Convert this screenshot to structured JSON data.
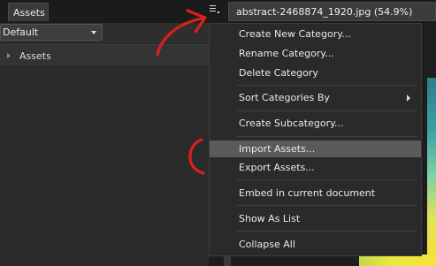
{
  "topbar": {
    "panel_tab": "Assets",
    "document_tab": "abstract-2468874_1920.jpg (54.9%)"
  },
  "toolbar": {
    "category_select": "Default"
  },
  "panel": {
    "category_label": "Assets"
  },
  "context_menu": {
    "items": [
      {
        "label": "Create New Category..."
      },
      {
        "label": "Rename Category..."
      },
      {
        "label": "Delete Category"
      },
      {
        "label": "Sort Categories By"
      },
      {
        "label": "Create Subcategory..."
      },
      {
        "label": "Import Assets..."
      },
      {
        "label": "Export Assets..."
      },
      {
        "label": "Embed in current document"
      },
      {
        "label": "Show As List"
      },
      {
        "label": "Collapse All"
      }
    ],
    "highlighted": "Import Assets...",
    "has_submenu": "Sort Categories By"
  },
  "colors": {
    "annotation_red": "#d8201f",
    "highlight": "#5a5a5a",
    "menu_bg": "#2a2a2a"
  },
  "icons": {
    "menu_button": "hamburger-menu-icon",
    "submenu": "chevron-right-icon",
    "select": "chevron-down-icon",
    "collapse": "triangle-right-icon"
  }
}
